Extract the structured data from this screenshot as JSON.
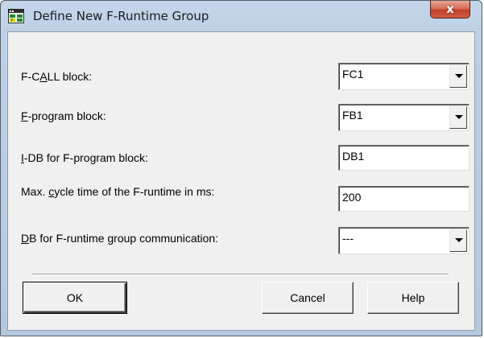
{
  "window": {
    "title": "Define New F-Runtime Group",
    "close_glyph": "x"
  },
  "fields": [
    {
      "label_prefix": "F-C",
      "label_accel": "A",
      "label_suffix": "LL block:",
      "type": "combo",
      "value": "FC1"
    },
    {
      "label_prefix": "",
      "label_accel": "F",
      "label_suffix": "-program block:",
      "type": "combo",
      "value": "FB1"
    },
    {
      "label_prefix": "",
      "label_accel": "I",
      "label_suffix": "-DB for F-program block:",
      "type": "text",
      "value": "DB1"
    },
    {
      "label_prefix": "Max. ",
      "label_accel": "c",
      "label_suffix": "ycle time of the F-runtime in ms:",
      "type": "text",
      "value": "200"
    },
    {
      "label_prefix": "",
      "label_accel": "D",
      "label_suffix": "B for F-runtime group communication:",
      "type": "combo",
      "value": "---"
    }
  ],
  "buttons": {
    "ok": "OK",
    "cancel": "Cancel",
    "help": "Help"
  },
  "icons": {
    "app": "runtime-group-icon",
    "close": "close-icon",
    "dropdown": "chevron-down-icon"
  },
  "colors": {
    "close_button": "#c1412a",
    "title_bar": "#bdd0e6",
    "dialog_face": "#f0f0f0"
  }
}
